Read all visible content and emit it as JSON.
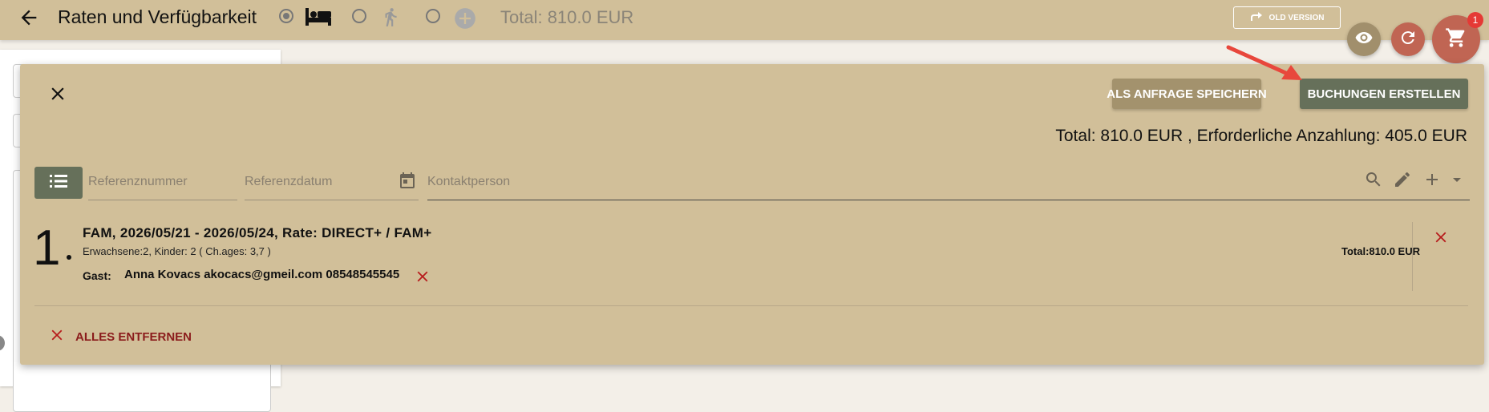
{
  "header": {
    "title": "Raten und Verfügbarkeit",
    "total": "Total: 810.0 EUR",
    "old_version_label": "OLD VERSION",
    "cart_count": "1",
    "filter_options": [
      {
        "icon": "bed-icon",
        "selected": true
      },
      {
        "icon": "walking-person-icon",
        "selected": false
      },
      {
        "icon": "add-circle-icon",
        "selected": false
      }
    ]
  },
  "panel": {
    "save_request_label": "ALS ANFRAGE SPEICHERN",
    "create_bookings_label": "BUCHUNGEN ERSTELLEN",
    "totals": "Total: 810.0 EUR , Erforderliche Anzahlung: 405.0 EUR",
    "fields": {
      "reference_number": "Referenznummer",
      "reference_date": "Referenzdatum",
      "contact_person": "Kontaktperson"
    },
    "items": [
      {
        "number": "1",
        "title": "FAM, 2026/05/21 - 2026/05/24, Rate: DIRECT+ / FAM+",
        "details": "Erwachsene:2, Kinder: 2 ( Ch.ages: 3,7 )",
        "guest_label": "Gast:",
        "guest": "Anna Kovacs akocacs@gmeil.com 08548545545",
        "total": "Total:810.0 EUR"
      }
    ],
    "remove_all_label": "ALLES ENTFERNEN"
  },
  "colors": {
    "panel_bg": "#d1bf99",
    "primary_button": "#66705a",
    "secondary_button": "#a3926d",
    "danger": "#8b1c1c",
    "fab_accent": "#c06553"
  }
}
